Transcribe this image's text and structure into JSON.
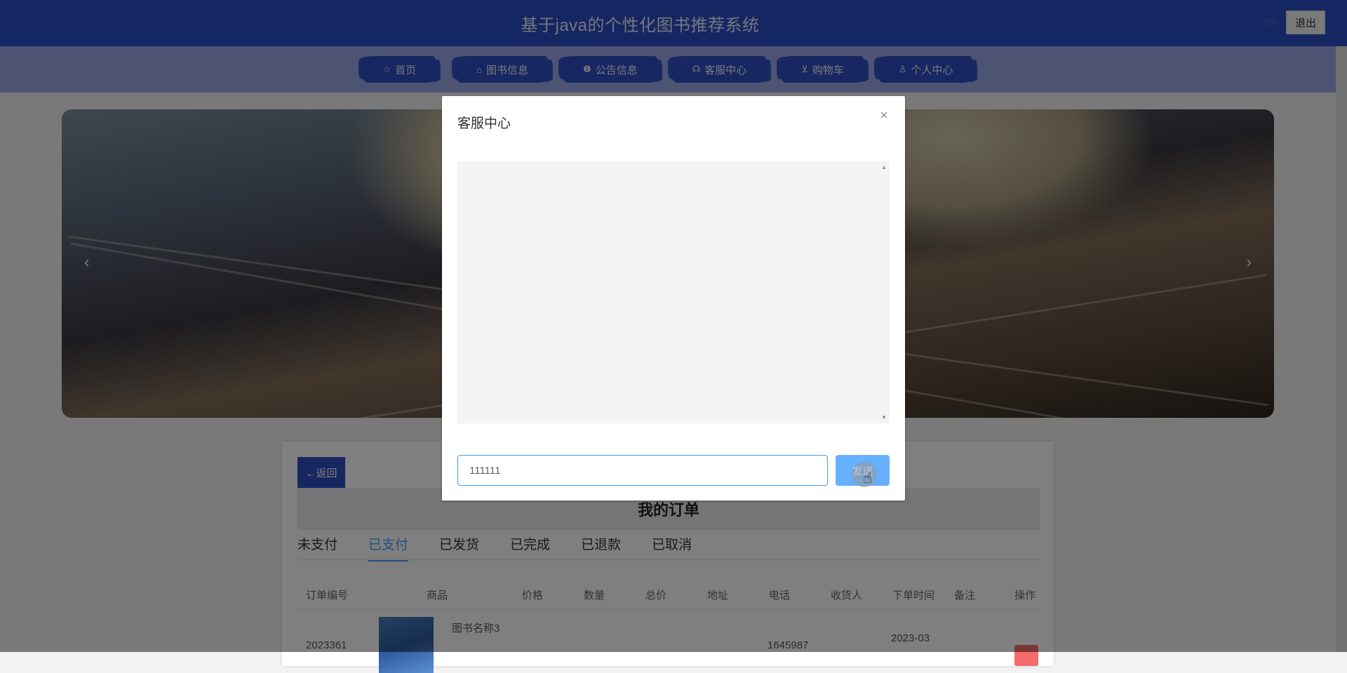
{
  "header": {
    "title": "基于java的个性化图书推荐系统",
    "logout_label": "退出"
  },
  "nav": {
    "items": [
      {
        "label": "首页",
        "icon": "star-icon",
        "glyph": "☆"
      },
      {
        "label": "图书信息",
        "icon": "bag-icon",
        "glyph": "⌂"
      },
      {
        "label": "公告信息",
        "icon": "info-icon",
        "glyph": "❶"
      },
      {
        "label": "客服中心",
        "icon": "headset-icon",
        "glyph": "☊"
      },
      {
        "label": "购物车",
        "icon": "cart-icon",
        "glyph": "⊻"
      },
      {
        "label": "个人中心",
        "icon": "user-icon",
        "glyph": "♙"
      }
    ]
  },
  "banner": {
    "prev_glyph": "‹",
    "next_glyph": "›"
  },
  "orders": {
    "back_label": "←返回",
    "title": "我的订单",
    "tabs": [
      "未支付",
      "已支付",
      "已发货",
      "已完成",
      "已退款",
      "已取消"
    ],
    "active_tab": "已支付",
    "columns": [
      "订单编号",
      "商品",
      "价格",
      "数量",
      "总价",
      "地址",
      "电话",
      "收货人",
      "下单时间",
      "备注",
      "操作"
    ],
    "row": {
      "order_no": "2023361",
      "book_name": "图书名称3",
      "phone": "1645987",
      "date": "2023-03"
    }
  },
  "dialog": {
    "title": "客服中心",
    "close_glyph": "×",
    "input_value": "111111",
    "send_label": "发送"
  }
}
